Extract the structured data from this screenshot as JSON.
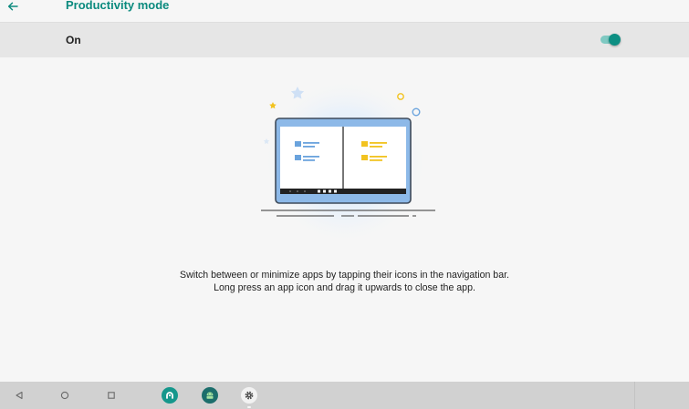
{
  "header": {
    "title": "Productivity mode"
  },
  "setting": {
    "label": "On",
    "enabled": true
  },
  "description": {
    "line1": "Switch between or minimize apps by tapping their icons in the navigation bar.",
    "line2": "Long press an app icon and drag it upwards to close the app."
  },
  "colors": {
    "accent": "#0d8f83",
    "toggle_track": "#7fc9c2",
    "illustration_blue": "#6aa3dd",
    "illustration_yellow": "#f2c320"
  },
  "navigation": {
    "buttons": [
      "back-triangle-icon",
      "home-circle-icon",
      "recents-square-icon"
    ],
    "apps": [
      "teal-app-icon",
      "android-icon",
      "settings-gear-icon"
    ]
  }
}
